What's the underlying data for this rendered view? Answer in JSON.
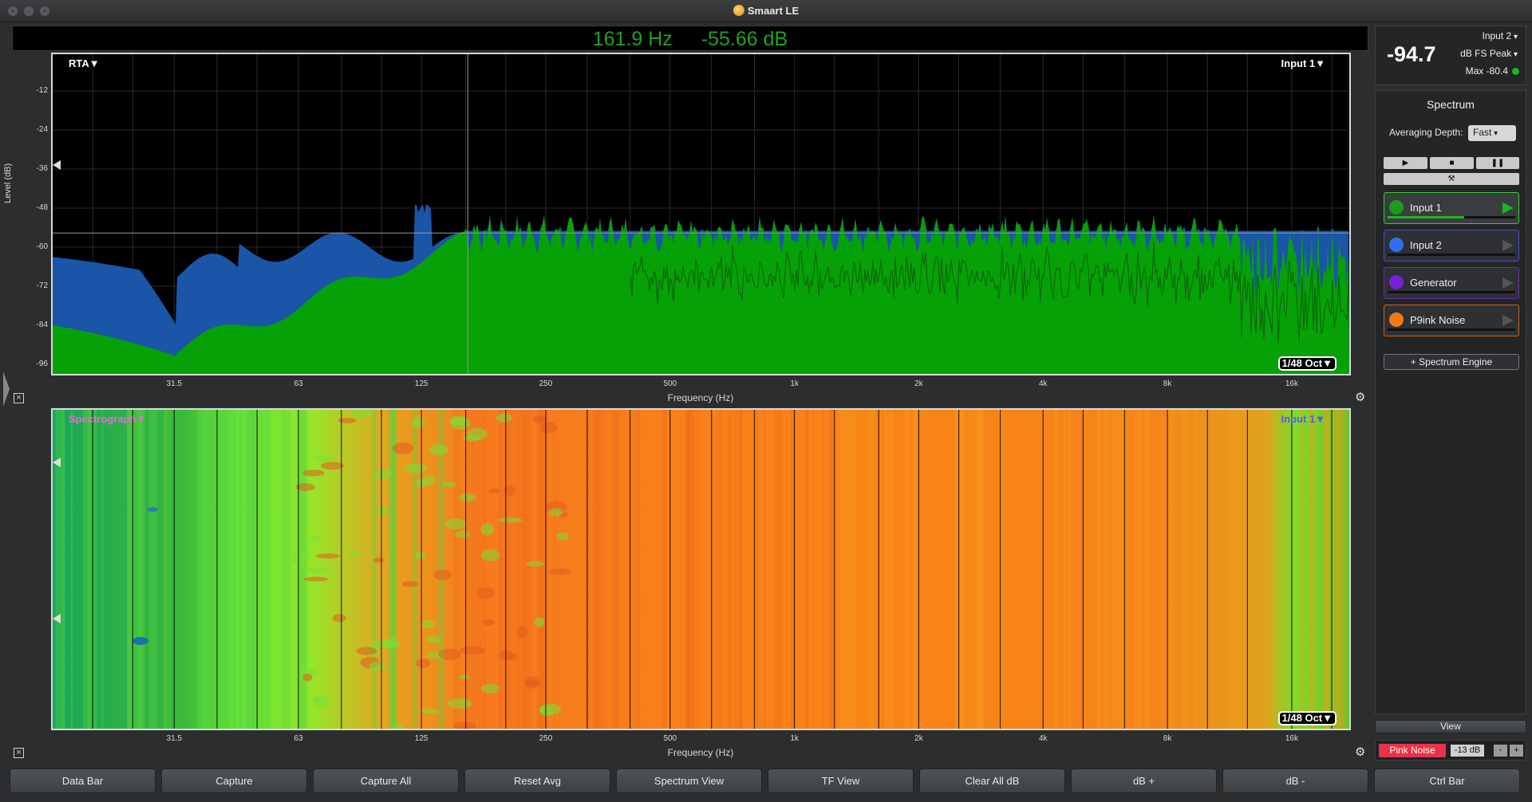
{
  "window": {
    "title": "Smaart LE"
  },
  "readout": {
    "frequency": "161.9 Hz",
    "level": "-55.66 dB"
  },
  "rta": {
    "mode_label": "RTA▼",
    "input_label": "Input 1▼",
    "resolution_label": "1/48 Oct▼",
    "y_axis_title": "Level (dB)",
    "y_ticks": [
      "-12",
      "-24",
      "-36",
      "-48",
      "-60",
      "-72",
      "-84",
      "-96"
    ],
    "x_axis_title": "Frequency (Hz)",
    "x_ticks": [
      "31.5",
      "63",
      "125",
      "250",
      "500",
      "1k",
      "2k",
      "4k",
      "8k",
      "16k"
    ],
    "cursor_frequency_hz": 161.9,
    "cursor_level_db": -55.66
  },
  "spectrograph": {
    "mode_label": "Spectrograph▼",
    "input_label": "Input 1▼",
    "resolution_label": "1/48 Oct▼",
    "x_axis_title": "Frequency (Hz)",
    "x_ticks": [
      "31.5",
      "63",
      "125",
      "250",
      "500",
      "1k",
      "2k",
      "4k",
      "8k",
      "16k"
    ]
  },
  "meter": {
    "input": "Input 2",
    "value": "-94.7",
    "mode": "dB FS Peak",
    "max": "Max -80.4",
    "max_indicator_color": "#1fb51f"
  },
  "spectrum_panel": {
    "title": "Spectrum",
    "averaging_label": "Averaging Depth:",
    "averaging_value": "Fast",
    "transport": [
      "play-icon",
      "stop-icon",
      "pause-icon"
    ],
    "tools_icon": "tools-icon",
    "channels": [
      {
        "name": "Input 1",
        "color": "#1e9a1e",
        "border": "#33cc33",
        "level": 0.6
      },
      {
        "name": "Input 2",
        "color": "#2f6ef0",
        "border": "#4a4cc8",
        "level": 0
      },
      {
        "name": "Generator",
        "color": "#7a1fd6",
        "border": "#6a2fb0",
        "level": 0
      },
      {
        "name": "P9ink Noise",
        "color": "#f07a18",
        "border": "#c8661c",
        "level": 0
      }
    ],
    "add_engine": "+ Spectrum Engine"
  },
  "view_button": "View",
  "generator": {
    "label": "Pink Noise",
    "level": "-13 dB",
    "minus": "-",
    "plus": "+",
    "color": "#e8314a"
  },
  "toolbar": [
    "Data Bar",
    "Capture",
    "Capture All",
    "Reset Avg",
    "Spectrum View",
    "TF View",
    "Clear All dB",
    "dB +",
    "dB -",
    "Ctrl Bar"
  ]
}
